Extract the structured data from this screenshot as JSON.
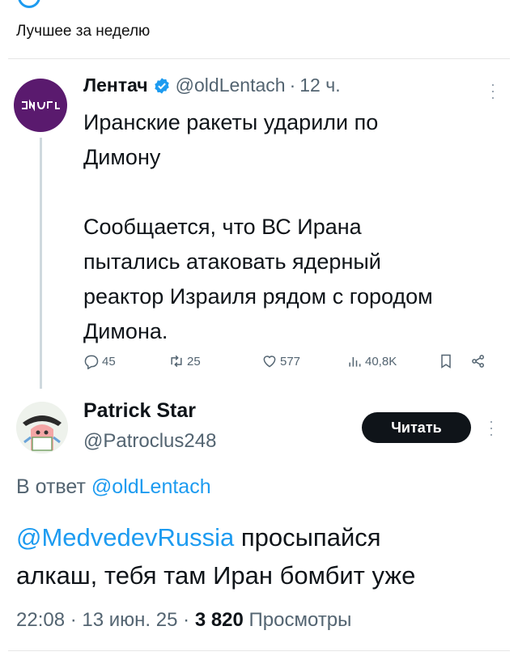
{
  "section": {
    "title": "Лучшее за неделю"
  },
  "tweet1": {
    "name": "Лентач",
    "handle": "@oldLentach",
    "separator": "·",
    "time": "12 ч.",
    "avatar_text": "ᒣᒋᔭᒍ",
    "body_line1": "Иранские ракеты ударили по",
    "body_line2": "Димону",
    "body_line3": "Сообщается, что ВС Ирана",
    "body_line4": "пытались атаковать ядерный",
    "body_line5": "реактор Израиля рядом с городом",
    "body_line6": "Димона.",
    "actions": {
      "replies": "45",
      "retweets": "25",
      "likes": "577",
      "views": "40,8K"
    },
    "icons": [
      "reply-icon",
      "retweet-icon",
      "like-icon",
      "views-icon",
      "bookmark-icon",
      "share-icon",
      "verified-badge-icon",
      "more-icon"
    ]
  },
  "tweet2": {
    "name": "Patrick Star",
    "handle": "@Patroclus248",
    "button_label": "Читать",
    "reply_prefix": "В ответ",
    "reply_handle": "@oldLentach",
    "mention": "@MedvedevRussia",
    "body_line1_rest": " просыпайся",
    "body_line2": "алкаш, тебя там Иран бомбит уже",
    "time": "22:08",
    "separator": "·",
    "date": "13 июн. 25",
    "views_count": "3 820",
    "views_label": "Просмотры"
  },
  "colors": {
    "link": "#1d9bf0",
    "text": "#0f1419",
    "muted": "#536471",
    "avatar_bg": "#5a1a6e"
  }
}
